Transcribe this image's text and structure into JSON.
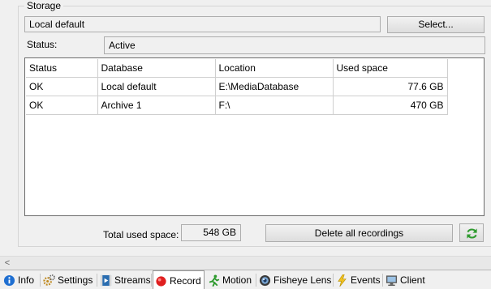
{
  "storage": {
    "group_title": "Storage",
    "name_value": "Local default",
    "select_label": "Select...",
    "status_label": "Status:",
    "status_value": "Active"
  },
  "grid": {
    "columns": [
      "Status",
      "Database",
      "Location",
      "Used space"
    ],
    "rows": [
      {
        "status": "OK",
        "database": "Local default",
        "location": "E:\\MediaDatabase",
        "used": "77.6 GB"
      },
      {
        "status": "OK",
        "database": "Archive 1",
        "location": "F:\\",
        "used": "470 GB"
      }
    ]
  },
  "footer": {
    "total_label": "Total used space:",
    "total_value": "548 GB",
    "delete_label": "Delete all recordings"
  },
  "scrollbar": {
    "left_arrow": "<"
  },
  "tabs": [
    {
      "label": "Info",
      "icon": "info-icon"
    },
    {
      "label": "Settings",
      "icon": "settings-icon"
    },
    {
      "label": "Streams",
      "icon": "streams-icon"
    },
    {
      "label": "Record",
      "icon": "record-icon",
      "active": true
    },
    {
      "label": "Motion",
      "icon": "motion-icon"
    },
    {
      "label": "Fisheye Lens",
      "icon": "fisheye-lens-icon"
    },
    {
      "label": "Events",
      "icon": "events-icon"
    },
    {
      "label": "Client",
      "icon": "client-icon"
    }
  ],
  "colors": {
    "refresh_green": "#2e9a2e",
    "record_red": "#e02020",
    "info_blue": "#1f6fd1"
  }
}
